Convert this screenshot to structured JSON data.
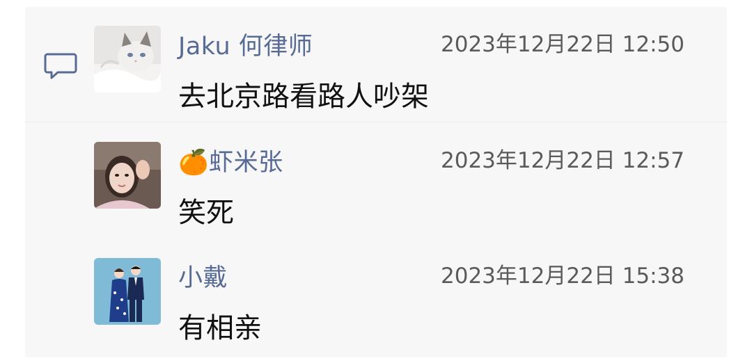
{
  "comments_panel": {
    "icon": "comment-icon",
    "entries": [
      {
        "name": "Jaku  何律师",
        "time": "2023年12月22日 12:50",
        "text": "去北京路看路人吵架",
        "avatar": "cat-photo-avatar"
      },
      {
        "name": "🍊虾米张",
        "time": "2023年12月22日 12:57",
        "text": "笑死",
        "avatar": "girl-photo-avatar"
      },
      {
        "name": "小戴",
        "time": "2023年12月22日 15:38",
        "text": "有相亲",
        "avatar": "couple-illustration-avatar"
      }
    ]
  }
}
